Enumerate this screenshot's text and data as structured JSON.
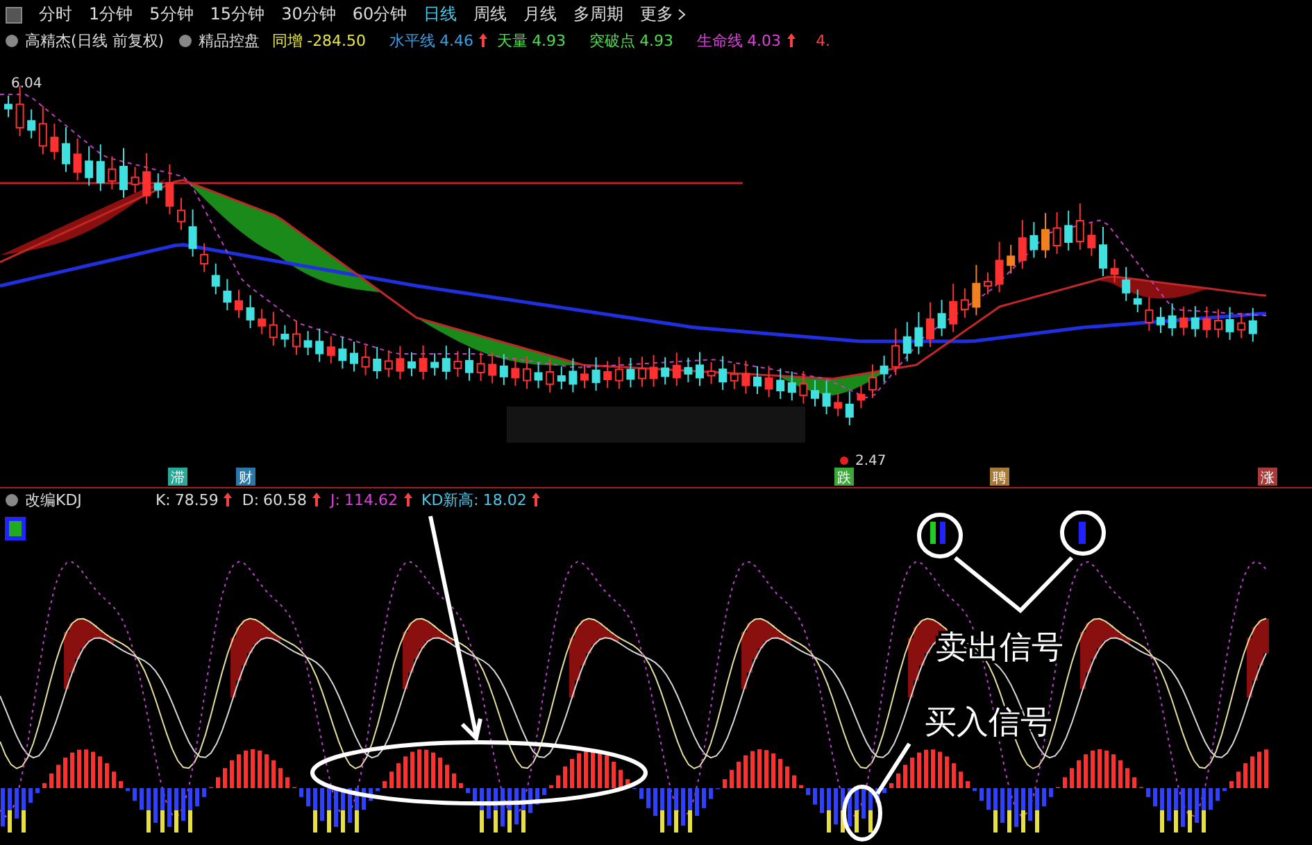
{
  "toolbar": {
    "tabs": [
      {
        "label": "分时",
        "selected": false
      },
      {
        "label": "1分钟",
        "selected": false
      },
      {
        "label": "5分钟",
        "selected": false
      },
      {
        "label": "15分钟",
        "selected": false
      },
      {
        "label": "30分钟",
        "selected": false
      },
      {
        "label": "60分钟",
        "selected": false
      },
      {
        "label": "日线",
        "selected": true
      },
      {
        "label": "周线",
        "selected": false
      },
      {
        "label": "月线",
        "selected": false
      },
      {
        "label": "多周期",
        "selected": false
      },
      {
        "label": "更多",
        "selected": false
      }
    ]
  },
  "main_chart": {
    "title": "高精杰(日线 前复权)",
    "indicator": "精品控盘",
    "values": [
      {
        "label": "同增",
        "value": "-284.50",
        "color": "#e8e84a",
        "up": false
      },
      {
        "label": "水平线",
        "value": "4.46",
        "color": "#3aa0e8",
        "up": true
      },
      {
        "label": "天量",
        "value": "4.93",
        "color": "#4ee04e",
        "up": false
      },
      {
        "label": "突破点",
        "value": "4.93",
        "color": "#4ee04e",
        "up": false
      },
      {
        "label": "生命线",
        "value": "4.03",
        "color": "#e040e0",
        "up": true
      }
    ],
    "cut_value": "4.",
    "high_price": "6.04",
    "low_price": "2.47",
    "markers": [
      {
        "label": "滞",
        "color": "#2aa898"
      },
      {
        "label": "财",
        "color": "#2a78a8"
      },
      {
        "label": "跌",
        "color": "#3aa83a"
      },
      {
        "label": "聘",
        "color": "#a87a3a"
      },
      {
        "label": "涨",
        "color": "#a83a3a"
      }
    ]
  },
  "kdj": {
    "title": "改编KDJ",
    "values": [
      {
        "label": "K:",
        "value": "78.59",
        "color": "#dddddd",
        "up": true
      },
      {
        "label": "D:",
        "value": "60.58",
        "color": "#dddddd",
        "up": true
      },
      {
        "label": "J:",
        "value": "114.62",
        "color": "#e040e0",
        "up": true
      },
      {
        "label": "KD新高:",
        "value": "18.02",
        "color": "#4ec8e8",
        "up": true
      }
    ],
    "annotations": [
      {
        "kind": "sell",
        "text": "卖出信号"
      },
      {
        "kind": "buy",
        "text": "买入信号"
      }
    ]
  }
}
